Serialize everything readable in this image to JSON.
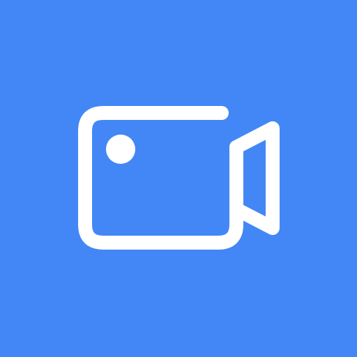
{
  "icon": {
    "name": "video-camera-icon",
    "background_color": "#4287F5",
    "foreground_color": "#FFFFFF"
  }
}
